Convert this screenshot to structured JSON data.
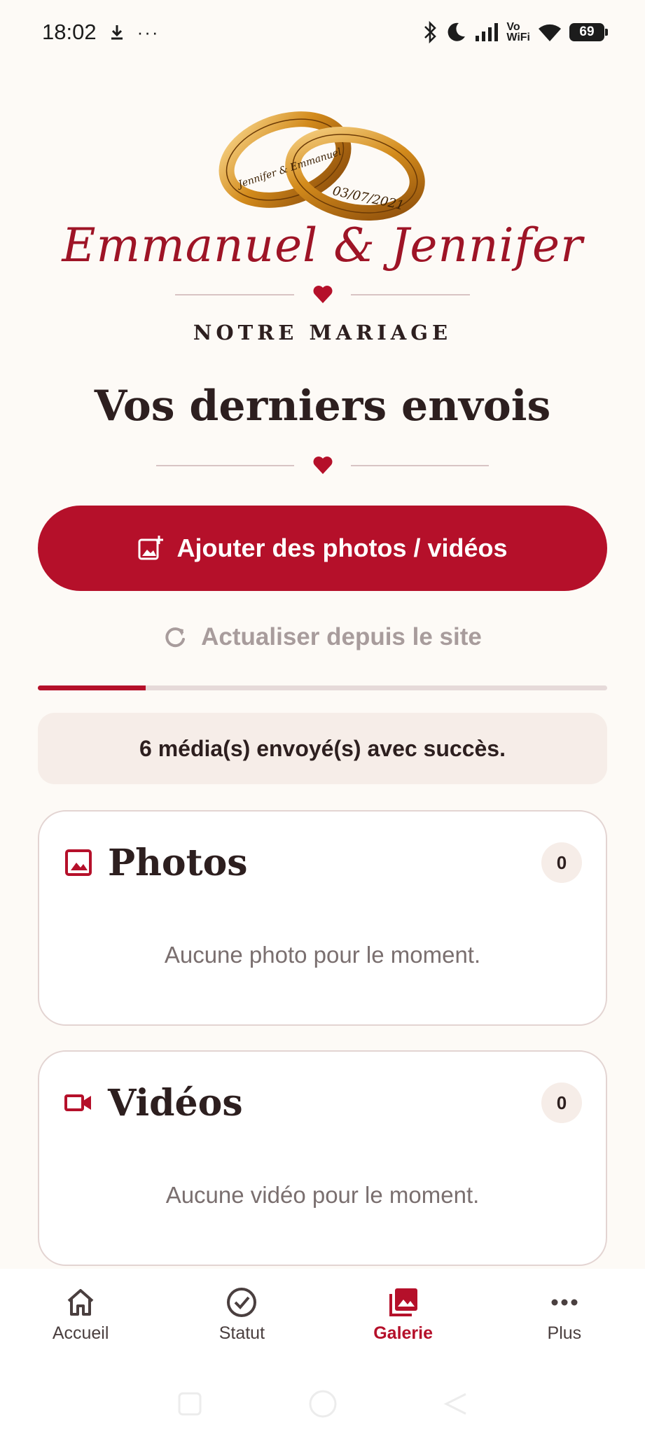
{
  "status_bar": {
    "time": "18:02",
    "download_icon": "download-arrow-icon",
    "more": "···",
    "vowifi_top": "Vo",
    "vowifi_bottom": "WiFi",
    "battery": "69"
  },
  "header": {
    "ring_engraving_1": "Jennifer & Emmanuel",
    "ring_engraving_2": "03/07/2021",
    "couple": "Emmanuel & Jennifer",
    "subtitle": "NOTRE MARIAGE",
    "page_title": "Vos derniers envois"
  },
  "actions": {
    "add_label": "Ajouter des photos / vidéos",
    "refresh_label": "Actualiser depuis le site"
  },
  "upload_progress": 0.19,
  "status_message": "6 média(s) envoyé(s) avec succès.",
  "sections": {
    "photos": {
      "title": "Photos",
      "count": "0",
      "empty": "Aucune photo pour le moment."
    },
    "videos": {
      "title": "Vidéos",
      "count": "0",
      "empty": "Aucune vidéo pour le moment."
    }
  },
  "nav": {
    "items": [
      {
        "label": "Accueil",
        "icon": "home-icon"
      },
      {
        "label": "Statut",
        "icon": "check-circle-icon"
      },
      {
        "label": "Galerie",
        "icon": "gallery-icon",
        "active": true
      },
      {
        "label": "Plus",
        "icon": "more-icon"
      }
    ]
  },
  "colors": {
    "accent": "#b5102a",
    "background": "#fdfaf6",
    "text": "#2d1f1f"
  }
}
